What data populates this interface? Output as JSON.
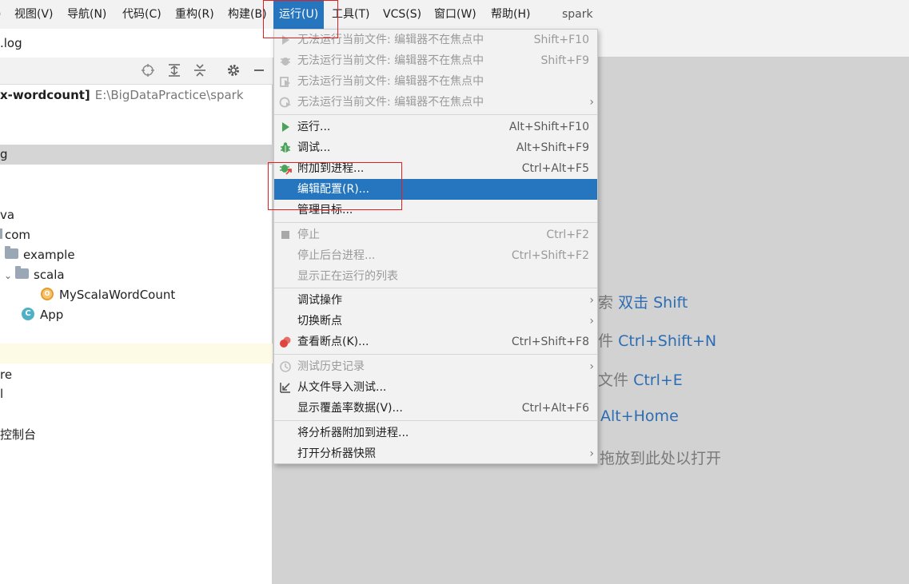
{
  "menubar": {
    "items": [
      "视图(V)",
      "导航(N)",
      "代码(C)",
      "重构(R)",
      "构建(B)",
      "运行(U)",
      "工具(T)",
      "VCS(S)",
      "窗口(W)",
      "帮助(H)"
    ],
    "edge_glyph": ")",
    "project_title": "spark"
  },
  "tab": {
    "label": ".log"
  },
  "project": {
    "root_name": "x-wordcount]",
    "root_path": "E:\\BigDataPractice\\spark",
    "rows": {
      "r_g": "g",
      "r_va": "va",
      "r_com": "com",
      "r_example": "example",
      "r_scala": "scala",
      "r_mswc": "MyScalaWordCount",
      "r_app": "App",
      "r_re": "re",
      "r_l": "l",
      "r_console": "控制台"
    },
    "class_letter": "C",
    "object_letter": "O"
  },
  "hints": {
    "h1_pre": "索",
    "h1_key": "双击 Shift",
    "h2_pre": "件",
    "h2_key": "Ctrl+Shift+N",
    "h3_pre": "文件",
    "h3_key": "Ctrl+E",
    "h4_key": "Alt+Home",
    "h5": "拖放到此处以打开"
  },
  "run_menu": {
    "items": [
      {
        "id": "run-current",
        "label": "无法运行当前文件: 编辑器不在焦点中",
        "shortcut": "Shift+F10",
        "icon": "play-icon"
      },
      {
        "id": "debug-current",
        "label": "无法运行当前文件: 编辑器不在焦点中",
        "shortcut": "Shift+F9",
        "icon": "bug-icon"
      },
      {
        "id": "coverage-current",
        "label": "无法运行当前文件: 编辑器不在焦点中",
        "shortcut": "",
        "icon": "coverage-icon"
      },
      {
        "id": "profile-current",
        "label": "无法运行当前文件: 编辑器不在焦点中",
        "shortcut": "",
        "icon": "profiler-icon"
      },
      {
        "id": "run",
        "label": "运行...",
        "shortcut": "Alt+Shift+F10",
        "icon": "play-icon"
      },
      {
        "id": "debug",
        "label": "调试...",
        "shortcut": "Alt+Shift+F9",
        "icon": "bug-icon"
      },
      {
        "id": "attach",
        "label": "附加到进程...",
        "shortcut": "Ctrl+Alt+F5",
        "icon": "attach-icon"
      },
      {
        "id": "edit-config",
        "label": "编辑配置(R)...",
        "shortcut": ""
      },
      {
        "id": "manage-targets",
        "label": "管理目标...",
        "shortcut": ""
      },
      {
        "id": "stop",
        "label": "停止",
        "shortcut": "Ctrl+F2",
        "icon": "stop-icon"
      },
      {
        "id": "stop-bg",
        "label": "停止后台进程...",
        "shortcut": "Ctrl+Shift+F2"
      },
      {
        "id": "show-running",
        "label": "显示正在运行的列表",
        "shortcut": ""
      },
      {
        "id": "debug-actions",
        "label": "调试操作",
        "shortcut": ""
      },
      {
        "id": "toggle-bp",
        "label": "切换断点",
        "shortcut": ""
      },
      {
        "id": "view-bp",
        "label": "查看断点(K)...",
        "shortcut": "Ctrl+Shift+F8",
        "icon": "breakpoints-icon"
      },
      {
        "id": "test-history",
        "label": "测试历史记录",
        "shortcut": "",
        "icon": "history-icon"
      },
      {
        "id": "import-tests",
        "label": "从文件导入测试...",
        "shortcut": "",
        "icon": "import-icon"
      },
      {
        "id": "show-coverage",
        "label": "显示覆盖率数据(V)...",
        "shortcut": "Ctrl+Alt+F6"
      },
      {
        "id": "attach-profiler",
        "label": "将分析器附加到进程...",
        "shortcut": ""
      },
      {
        "id": "open-snapshot",
        "label": "打开分析器快照",
        "shortcut": ""
      }
    ],
    "submenu_arrow": "›"
  },
  "colors": {
    "accent": "#2675bf",
    "highlight_box": "#e02020",
    "play_green": "#4aa35a",
    "bug_green": "#4aa35a",
    "breakpoint_red": "#e0443e"
  }
}
